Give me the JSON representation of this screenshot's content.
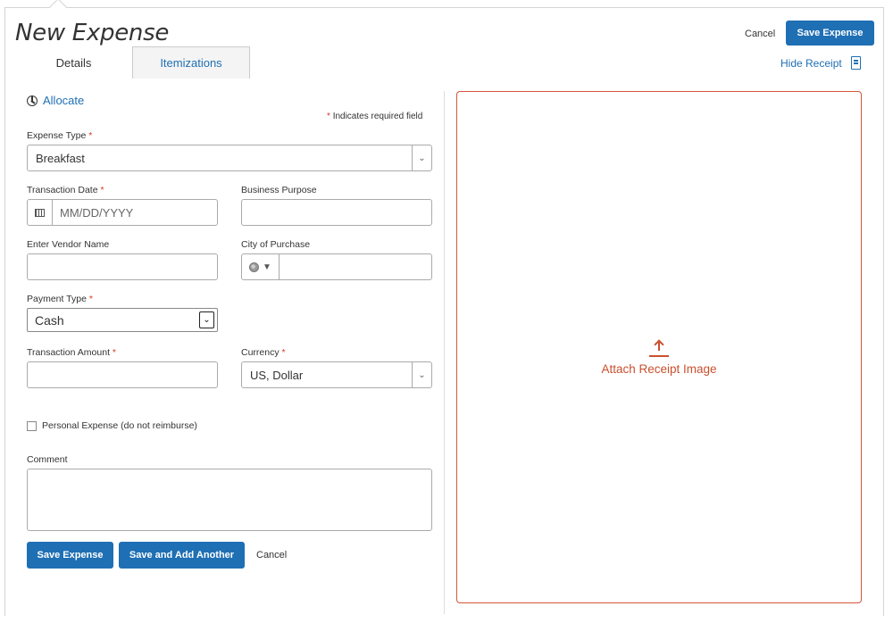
{
  "header": {
    "title": "New Expense",
    "cancel_label": "Cancel",
    "save_label": "Save Expense",
    "hide_receipt_label": "Hide Receipt"
  },
  "tabs": [
    {
      "label": "Details",
      "active": true
    },
    {
      "label": "Itemizations",
      "active": false
    }
  ],
  "form": {
    "allocate_label": "Allocate",
    "required_note": "Indicates required field",
    "required_marker": "*",
    "expense_type": {
      "label": "Expense Type",
      "value": "Breakfast"
    },
    "transaction_date": {
      "label": "Transaction Date",
      "placeholder": "MM/DD/YYYY"
    },
    "business_purpose": {
      "label": "Business Purpose",
      "value": ""
    },
    "vendor_name": {
      "label": "Enter Vendor Name",
      "value": ""
    },
    "city_of_purchase": {
      "label": "City of Purchase",
      "value": ""
    },
    "payment_type": {
      "label": "Payment Type",
      "value": "Cash"
    },
    "transaction_amount": {
      "label": "Transaction Amount",
      "value": ""
    },
    "currency": {
      "label": "Currency",
      "value": "US, Dollar"
    },
    "personal_expense_label": "Personal Expense (do not reimburse)",
    "personal_expense_checked": false,
    "comment": {
      "label": "Comment",
      "value": ""
    }
  },
  "footer": {
    "save_label": "Save Expense",
    "save_add_label": "Save and Add Another",
    "cancel_label": "Cancel"
  },
  "receipt": {
    "attach_label": "Attach Receipt Image"
  },
  "colors": {
    "primary": "#1f6fb4",
    "required": "#d93a2b",
    "receipt_accent": "#c9502f"
  }
}
